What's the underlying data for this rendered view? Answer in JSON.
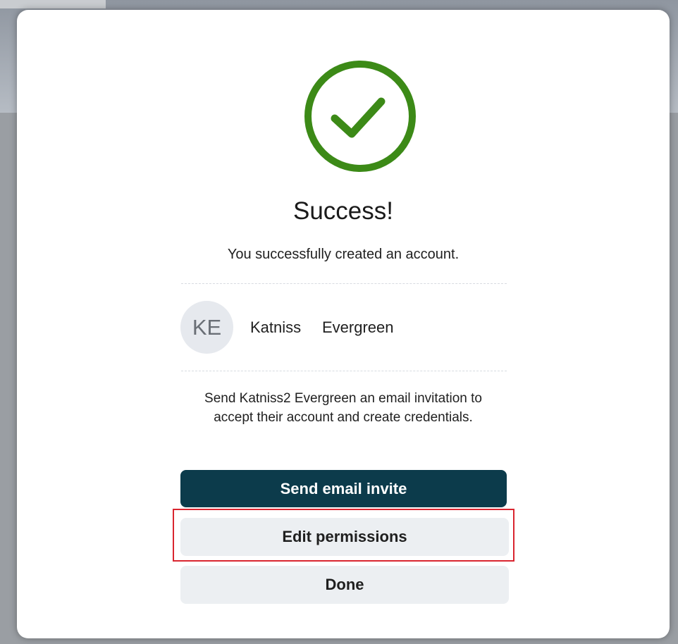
{
  "dialog": {
    "title": "Success!",
    "message": "You successfully created an account.",
    "icon": "check-circle-icon",
    "accent_color": "#3c8a17"
  },
  "user": {
    "initials": "KE",
    "first_name": "Katniss",
    "last_name": "Evergreen"
  },
  "invite": {
    "line1": "Send Katniss2 Evergreen an email invitation to",
    "line2": "accept their account and create credentials."
  },
  "buttons": {
    "send_invite": "Send email invite",
    "edit_permissions": "Edit permissions",
    "done": "Done"
  },
  "colors": {
    "primary_button": "#0c3b4b",
    "secondary_button": "#eceff2",
    "highlight": "#d9252f"
  }
}
